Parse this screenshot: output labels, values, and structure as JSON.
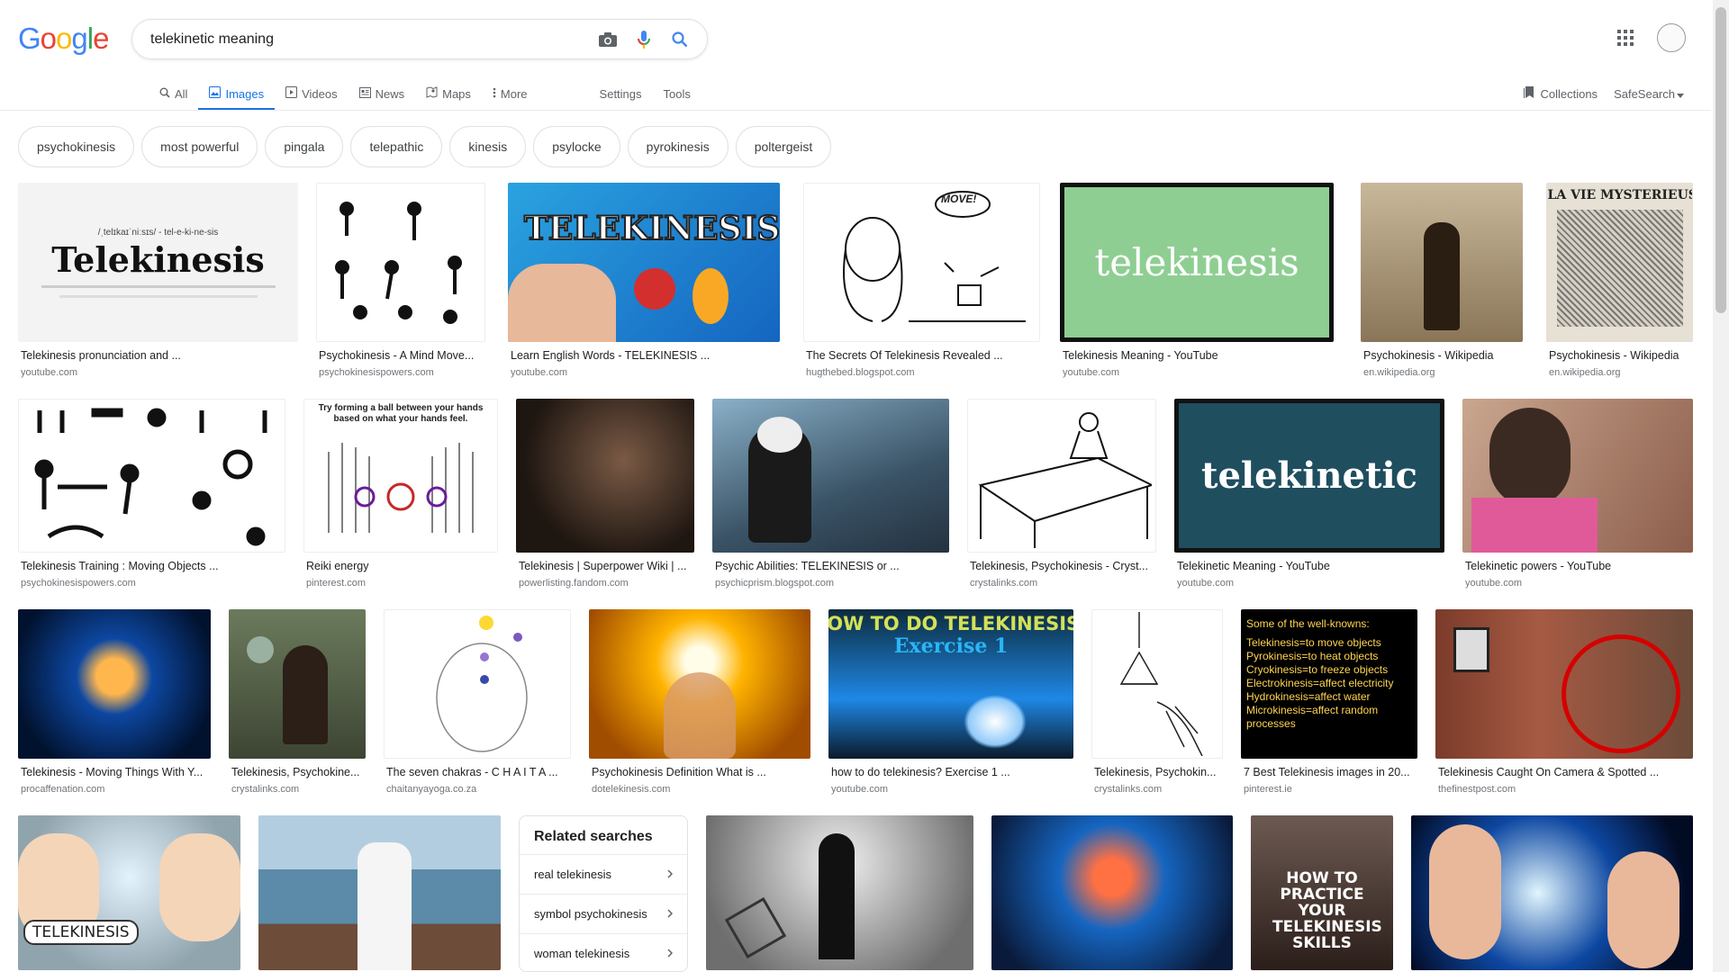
{
  "header": {
    "logo": [
      "G",
      "o",
      "o",
      "g",
      "l",
      "e"
    ],
    "logo_colors": [
      "#4285f4",
      "#ea4335",
      "#fbbc05",
      "#4285f4",
      "#34a853",
      "#ea4335"
    ],
    "query": "telekinetic meaning"
  },
  "tabs": [
    {
      "label": "All",
      "icon": "search-icon"
    },
    {
      "label": "Images",
      "icon": "image-icon",
      "active": true
    },
    {
      "label": "Videos",
      "icon": "video-icon"
    },
    {
      "label": "News",
      "icon": "news-icon"
    },
    {
      "label": "Maps",
      "icon": "map-icon"
    },
    {
      "label": "More",
      "icon": "more-vert-icon"
    }
  ],
  "tools": {
    "settings": "Settings",
    "tools": "Tools",
    "collections": "Collections",
    "safesearch": "SafeSearch"
  },
  "chips": [
    "psychokinesis",
    "most powerful",
    "pingala",
    "telepathic",
    "kinesis",
    "psylocke",
    "pyrokinesis",
    "poltergeist"
  ],
  "row1": [
    {
      "caption": "Telekinesis pronunciation and ...",
      "source": "youtube.com",
      "overlay": "Telekinesis"
    },
    {
      "caption": "Psychokinesis - A Mind Move...",
      "source": "psychokinesispowers.com"
    },
    {
      "caption": "Learn English Words - TELEKINESIS ...",
      "source": "youtube.com",
      "overlay": "TELEKINESIS"
    },
    {
      "caption": "The Secrets Of Telekinesis Revealed ...",
      "source": "hugthebed.blogspot.com",
      "overlay": "MOVE!"
    },
    {
      "caption": "Telekinesis Meaning - YouTube",
      "source": "youtube.com",
      "overlay": "telekinesis"
    },
    {
      "caption": "Psychokinesis - Wikipedia",
      "source": "en.wikipedia.org"
    },
    {
      "caption": "Psychokinesis - Wikipedia",
      "source": "en.wikipedia.org",
      "overlay": "LA VIE MYSTERIEUSE"
    }
  ],
  "row2": [
    {
      "caption": "Telekinesis Training : Moving Objects ...",
      "source": "psychokinesispowers.com"
    },
    {
      "caption": "Reiki energy",
      "source": "pinterest.com",
      "overlay": "Try forming a ball between your hands based on what your hands feel."
    },
    {
      "caption": "Telekinesis | Superpower Wiki | ...",
      "source": "powerlisting.fandom.com"
    },
    {
      "caption": "Psychic Abilities: TELEKINESIS or ...",
      "source": "psychicprism.blogspot.com"
    },
    {
      "caption": "Telekinesis, Psychokinesis - Cryst...",
      "source": "crystalinks.com"
    },
    {
      "caption": "Telekinetic Meaning - YouTube",
      "source": "youtube.com",
      "overlay": "telekinetic"
    },
    {
      "caption": "Telekinetic powers - YouTube",
      "source": "youtube.com"
    }
  ],
  "row3": [
    {
      "caption": "Telekinesis - Moving Things With Y...",
      "source": "procaffenation.com"
    },
    {
      "caption": "Telekinesis, Psychokine...",
      "source": "crystalinks.com"
    },
    {
      "caption": "The seven chakras - C H A I T A ...",
      "source": "chaitanyayoga.co.za"
    },
    {
      "caption": "Psychokinesis Definition What is ...",
      "source": "dotelekinesis.com"
    },
    {
      "caption": "how to do telekinesis? Exercise 1 ...",
      "source": "youtube.com",
      "overlay": "HOW TO DO TELEKINESIS?",
      "overlay2": "Exercise 1"
    },
    {
      "caption": "Telekinesis, Psychokin...",
      "source": "crystalinks.com"
    },
    {
      "caption": "7 Best Telekinesis images in 20...",
      "source": "pinterest.ie",
      "overlay_lines": [
        "Some of the well-knowns:",
        "Telekinesis=to move objects",
        "Pyrokinesis=to heat objects",
        "Cryokinesis=to freeze objects",
        "Electrokinesis=affect electricity",
        "Hydrokinesis=affect water",
        "Microkinesis=affect random processes"
      ]
    },
    {
      "caption": "Telekinesis Caught On Camera & Spotted ...",
      "source": "thefinestpost.com"
    }
  ],
  "row4": [
    {
      "overlay": "TELEKINESIS"
    },
    {},
    {},
    {},
    {
      "overlay": "HOW TO PRACTICE YOUR TELEKINESIS SKILLS"
    },
    {}
  ],
  "related": {
    "title": "Related searches",
    "items": [
      "real telekinesis",
      "symbol psychokinesis",
      "woman telekinesis"
    ]
  }
}
